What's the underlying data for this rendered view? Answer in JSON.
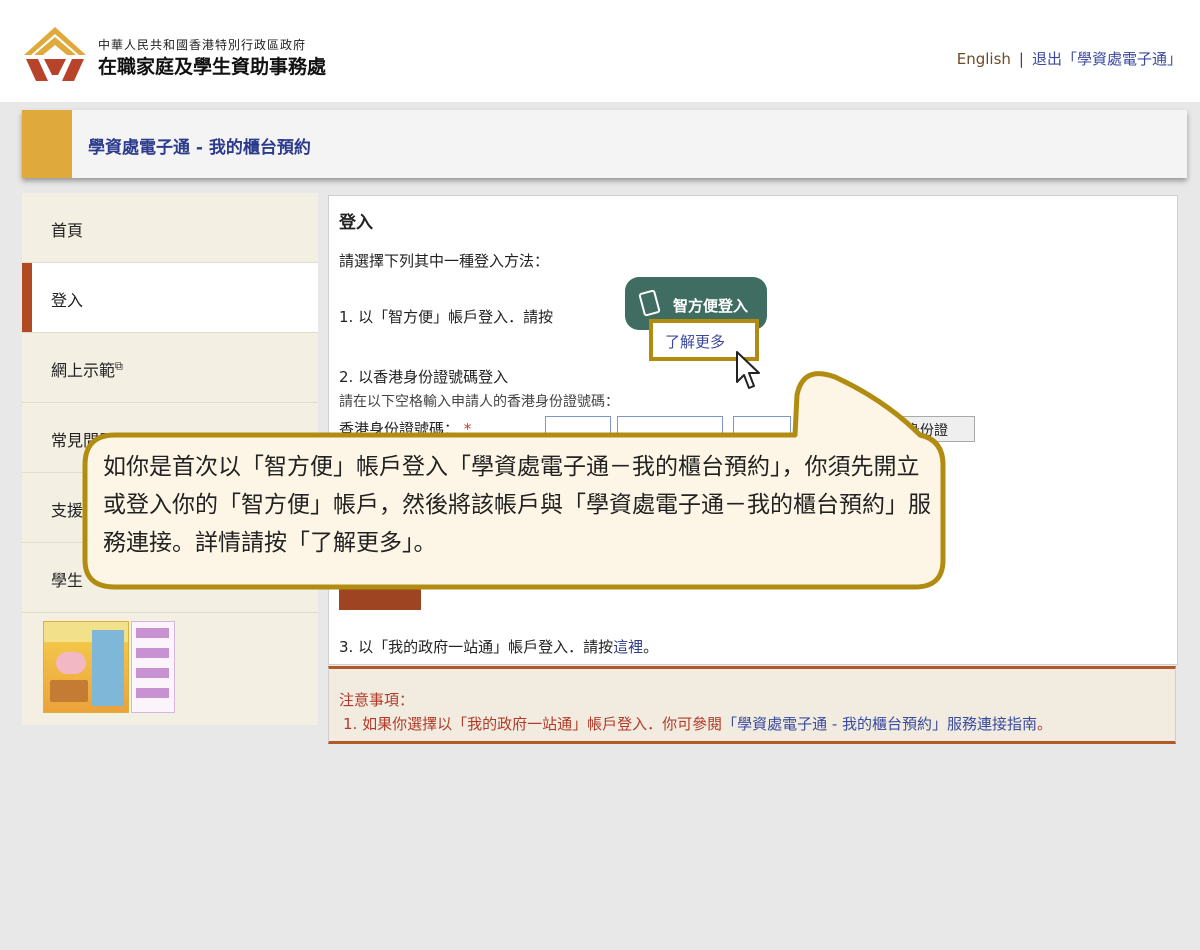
{
  "header": {
    "org_small": "中華人民共和國香港特別行政區政府",
    "org_big": "在職家庭及學生資助事務處",
    "english_link": "English",
    "separator": "|",
    "logout_link": "退出「學資處電子通」"
  },
  "banner": {
    "title": "學資處電子通 - 我的櫃台預約"
  },
  "sidebar": {
    "items": [
      {
        "label": "首頁",
        "active": false
      },
      {
        "label": "登入",
        "active": true
      },
      {
        "label": "網上示範",
        "active": false,
        "external": true
      },
      {
        "label": "常見問題",
        "active": false,
        "external": true
      },
      {
        "label": "支援",
        "active": false
      },
      {
        "label": "學生",
        "active": false
      }
    ]
  },
  "main": {
    "heading": "登入",
    "intro": "請選擇下列其中一種登入方法：",
    "option1": "1. 以「智方便」帳戶登入．請按",
    "iamsmart_button": "智方便登入",
    "learn_more": "了解更多",
    "option2": "2. 以香港身份證號碼登入",
    "option2_sub": "請在以下空格輸入申請人的香港身份證號碼：",
    "id_label": "香港身份證號碼：",
    "required_mark": "*",
    "read_id_button": "讀取香港身份證號碼",
    "option3_prefix": "3. 以「我的政府一站通」帳戶登入．請按",
    "option3_link": "這裡",
    "option3_suffix": "。"
  },
  "notes": {
    "title": "注意事項：",
    "item1_prefix": "1. 如果你選擇以「我的政府一站通」帳戶登入．你可參閱",
    "item1_link": "「學資處電子通 - 我的櫃台預約」服務連接指南",
    "item1_suffix": "。"
  },
  "callout": {
    "text": "如你是首次以「智方便」帳戶登入「學資處電子通－我的櫃台預約」，你須先開立或登入你的「智方便」帳戶，然後將該帳戶與「學資處電子通－我的櫃台預約」服務連接。詳情請按「了解更多」。"
  },
  "colors": {
    "accent_gold": "#e0a93b",
    "active_marker": "#b04a22",
    "iamsmart_green": "#3f6d62",
    "link_blue": "#3b4aa0",
    "callout_border": "#b18c10",
    "callout_fill": "#fdf6e6"
  }
}
